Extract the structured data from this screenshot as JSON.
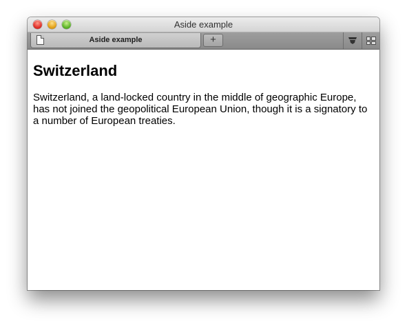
{
  "window": {
    "title": "Aside example"
  },
  "tabbar": {
    "tabs": [
      {
        "label": "Aside example",
        "icon": "page-icon"
      }
    ],
    "new_tab_label": "+",
    "icons": {
      "bookmarks": "bookmarks-icon",
      "top_sites": "top-sites-icon"
    }
  },
  "page": {
    "heading": "Switzerland",
    "paragraph": "Switzerland, a land-locked country in the middle of geographic Europe, has not joined the geopolitical European Union, though it is a signatory to a number of European treaties."
  },
  "colors": {
    "close": "#e0302a",
    "minimize": "#e3a21a",
    "zoom": "#5fb52a"
  }
}
